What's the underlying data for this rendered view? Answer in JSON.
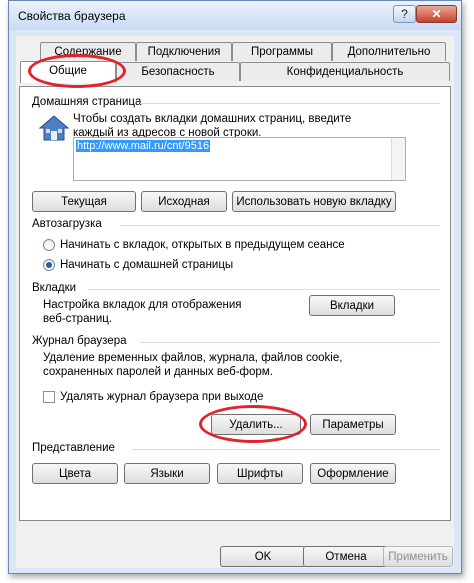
{
  "window": {
    "title": "Свойства браузера",
    "help_label": "?",
    "close_label": "✕"
  },
  "tabs_row1": [
    "Содержание",
    "Подключения",
    "Программы",
    "Дополнительно"
  ],
  "tabs_row2": [
    "Общие",
    "Безопасность",
    "Конфиденциальность"
  ],
  "home": {
    "group_label": "Домашняя страница",
    "description": "Чтобы создать вкладки домашних страниц, введите каждый из адресов с новой строки.",
    "url": "http://www.mail.ru/cnt/9516",
    "btn_current": "Текущая",
    "btn_default": "Исходная",
    "btn_new_tab": "Использовать новую вкладку"
  },
  "startup": {
    "group_label": "Автозагрузка",
    "option1": "Начинать с вкладок, открытых в предыдущем сеансе",
    "option2": "Начинать с домашней страницы"
  },
  "tabs_section": {
    "group_label": "Вкладки",
    "description": "Настройка вкладок для отображения веб-страниц.",
    "button": "Вкладки"
  },
  "history": {
    "group_label": "Журнал браузера",
    "description": "Удаление временных файлов, журнала, файлов cookie, сохраненных паролей и данных веб-форм.",
    "checkbox": "Удалять журнал браузера при выходе",
    "btn_delete": "Удалить...",
    "btn_settings": "Параметры"
  },
  "appearance": {
    "group_label": "Представление",
    "btn_colors": "Цвета",
    "btn_languages": "Языки",
    "btn_fonts": "Шрифты",
    "btn_accessibility": "Оформление"
  },
  "footer": {
    "ok": "OK",
    "cancel": "Отмена",
    "apply": "Применить"
  },
  "colors": {
    "highlight": "#e0232d",
    "selection": "#3399ff"
  }
}
